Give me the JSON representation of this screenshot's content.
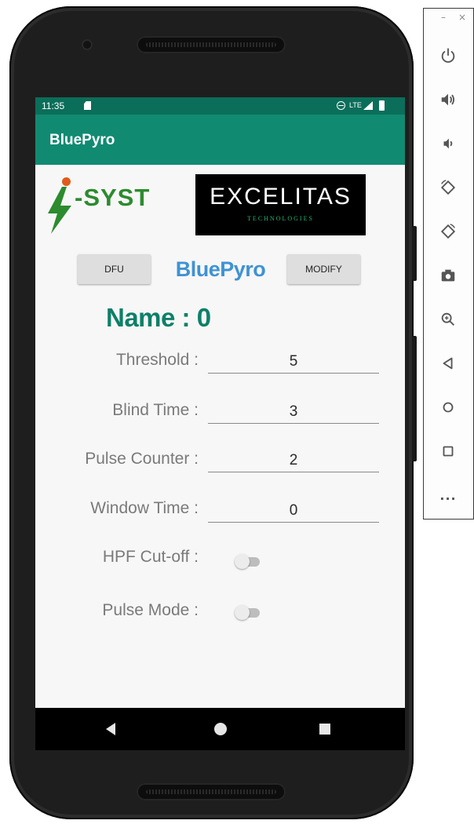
{
  "status_bar": {
    "time": "11:35",
    "network": "LTE"
  },
  "app_bar": {
    "title": "BluePyro"
  },
  "logos": {
    "isyst_text": "-SYST",
    "excelitas_name": "EXCELITAS",
    "excelitas_sub": "TECHNOLOGIES"
  },
  "actions": {
    "dfu_label": "DFU",
    "modify_label": "MODIFY",
    "center_title": "BluePyro"
  },
  "device": {
    "name_line": "Name : 0"
  },
  "fields": [
    {
      "label": "Threshold :",
      "value": "5"
    },
    {
      "label": "Blind Time :",
      "value": "3"
    },
    {
      "label": "Pulse Counter :",
      "value": "2"
    },
    {
      "label": "Window Time :",
      "value": "0"
    }
  ],
  "toggles": [
    {
      "label": "HPF Cut-off :",
      "on": false
    },
    {
      "label": "Pulse Mode :",
      "on": false
    }
  ],
  "colors": {
    "status_bar": "#0b6e5a",
    "app_bar": "#118a72",
    "title_blue": "#3f92d4",
    "name_green": "#0e7f69"
  },
  "emulator_toolbar": {
    "window_controls": [
      "–",
      "×"
    ],
    "buttons": [
      "power-icon",
      "volume-up-icon",
      "volume-down-icon",
      "rotate-left-icon",
      "rotate-right-icon",
      "camera-icon",
      "zoom-icon",
      "back-icon",
      "home-icon",
      "overview-icon",
      "more-icon"
    ],
    "more_label": "..."
  }
}
